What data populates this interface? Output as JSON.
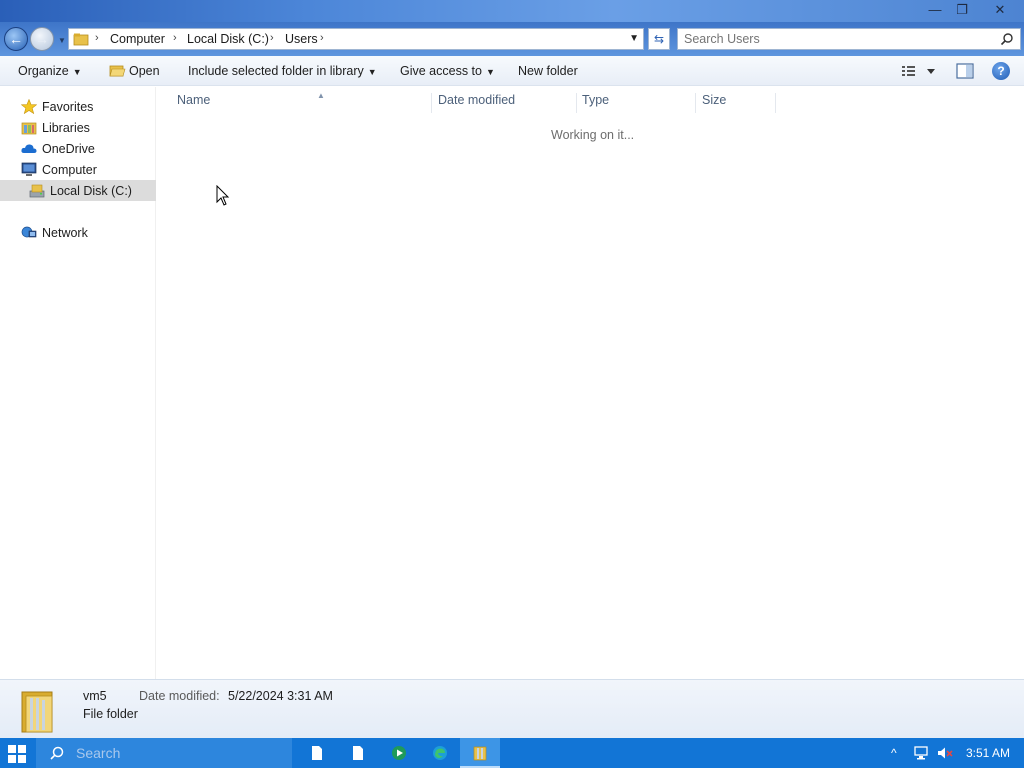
{
  "window": {
    "minimize_glyph": "—",
    "restore_glyph": "❐",
    "close_glyph": "✕"
  },
  "address": {
    "crumbs": [
      "Computer",
      "Local Disk (C:)",
      "Users"
    ],
    "separator": "›"
  },
  "search": {
    "placeholder": "Search Users"
  },
  "toolbar": {
    "organize": "Organize",
    "open": "Open",
    "include": "Include selected folder in library",
    "give_access": "Give access to",
    "new_folder": "New folder"
  },
  "nav": {
    "favorites": "Favorites",
    "libraries": "Libraries",
    "onedrive": "OneDrive",
    "computer": "Computer",
    "local_disk": "Local Disk (C:)",
    "network": "Network"
  },
  "columns": {
    "name": "Name",
    "date_modified": "Date modified",
    "type": "Type",
    "size": "Size"
  },
  "content": {
    "status": "Working on it..."
  },
  "details": {
    "name": "vm5",
    "date_label": "Date modified:",
    "date_value": "5/22/2024 3:31 AM",
    "type": "File folder"
  },
  "taskbar": {
    "search_placeholder": "Search",
    "time": "3:51 AM"
  },
  "colors": {
    "taskbar": "#1275d6",
    "selection": "#dcdcdc",
    "folder": "#e8c14a"
  }
}
